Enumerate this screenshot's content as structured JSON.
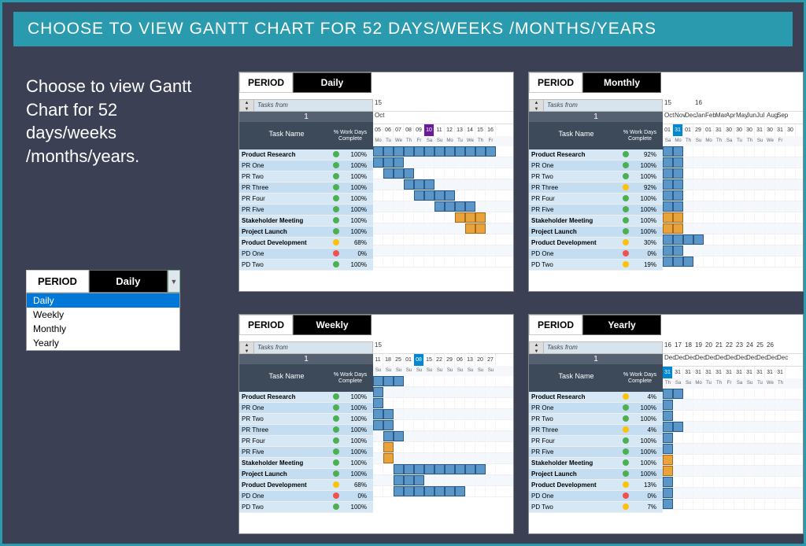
{
  "title": "CHOOSE TO VIEW GANTT CHART FOR 52 DAYS/WEEKS /MONTHS/YEARS",
  "description": "Choose to view Gantt Chart for 52 days/weeks /months/years.",
  "period_label": "PERIOD",
  "dropdown": {
    "selected": "Daily",
    "options": [
      "Daily",
      "Weekly",
      "Monthly",
      "Yearly"
    ]
  },
  "tasks_from_label": "Tasks from",
  "spin_value": "1",
  "task_name_header": "Task Name",
  "work_days_header": "% Work Days Complete",
  "tasks": [
    {
      "name": "Product Research",
      "bold": true
    },
    {
      "name": "PR One"
    },
    {
      "name": "PR Two"
    },
    {
      "name": "PR Three"
    },
    {
      "name": "PR Four"
    },
    {
      "name": "PR Five"
    },
    {
      "name": "Stakeholder Meeting",
      "bold": true
    },
    {
      "name": "Project Launch",
      "bold": true
    },
    {
      "name": "Product Development",
      "bold": true
    },
    {
      "name": "PD One"
    },
    {
      "name": "PD Two"
    }
  ],
  "panels": {
    "daily": {
      "period": "Daily",
      "year_row": [
        "15"
      ],
      "month_row": [
        "Oct"
      ],
      "dates": [
        "05",
        "06",
        "07",
        "08",
        "09",
        "10",
        "11",
        "12",
        "13",
        "14",
        "15",
        "16"
      ],
      "highlight": 5,
      "dow": [
        "Mo",
        "Tu",
        "We",
        "Th",
        "Fr",
        "Sa",
        "Su",
        "Mo",
        "Tu",
        "We",
        "Th",
        "Fr"
      ],
      "rows": [
        {
          "dot": "g",
          "pct": "100%",
          "bars": [
            [
              0,
              11,
              "b"
            ]
          ]
        },
        {
          "dot": "g",
          "pct": "100%",
          "bars": [
            [
              0,
              2,
              "b"
            ]
          ]
        },
        {
          "dot": "g",
          "pct": "100%",
          "bars": [
            [
              1,
              3,
              "b"
            ]
          ]
        },
        {
          "dot": "g",
          "pct": "100%",
          "bars": [
            [
              3,
              5,
              "b"
            ]
          ]
        },
        {
          "dot": "g",
          "pct": "100%",
          "bars": [
            [
              4,
              7,
              "b"
            ]
          ]
        },
        {
          "dot": "g",
          "pct": "100%",
          "bars": [
            [
              6,
              9,
              "b"
            ]
          ]
        },
        {
          "dot": "g",
          "pct": "100%",
          "bars": [
            [
              8,
              10,
              "o"
            ]
          ]
        },
        {
          "dot": "g",
          "pct": "100%",
          "bars": [
            [
              9,
              10,
              "o"
            ]
          ]
        },
        {
          "dot": "y",
          "pct": "68%",
          "bars": []
        },
        {
          "dot": "r",
          "pct": "0%",
          "bars": []
        },
        {
          "dot": "g",
          "pct": "100%",
          "bars": []
        }
      ]
    },
    "monthly": {
      "period": "Monthly",
      "year_row": [
        "15",
        "",
        "",
        "16"
      ],
      "month_row": [
        "Oct",
        "Nov",
        "Dec",
        "Jan",
        "Feb",
        "Mar",
        "Apr",
        "May",
        "Jun",
        "Jul",
        "Aug",
        "Sep"
      ],
      "dates": [
        "01",
        "31",
        "01",
        "29",
        "01",
        "31",
        "30",
        "30",
        "30",
        "31",
        "30",
        "31",
        "30"
      ],
      "highlight": 1,
      "dow": [
        "Sa",
        "Mo",
        "Th",
        "Su",
        "Mo",
        "Th",
        "Sa",
        "Tu",
        "Th",
        "Su",
        "We",
        "Fr"
      ],
      "rows": [
        {
          "dot": "g",
          "pct": "92%",
          "bars": [
            [
              0,
              1,
              "b"
            ]
          ]
        },
        {
          "dot": "g",
          "pct": "100%",
          "bars": [
            [
              0,
              1,
              "b"
            ]
          ]
        },
        {
          "dot": "g",
          "pct": "100%",
          "bars": [
            [
              0,
              1,
              "b"
            ]
          ]
        },
        {
          "dot": "y",
          "pct": "92%",
          "bars": [
            [
              0,
              1,
              "b"
            ]
          ]
        },
        {
          "dot": "g",
          "pct": "100%",
          "bars": [
            [
              0,
              1,
              "b"
            ]
          ]
        },
        {
          "dot": "g",
          "pct": "100%",
          "bars": [
            [
              0,
              1,
              "b"
            ]
          ]
        },
        {
          "dot": "g",
          "pct": "100%",
          "bars": [
            [
              0,
              1,
              "o"
            ]
          ]
        },
        {
          "dot": "g",
          "pct": "100%",
          "bars": [
            [
              0,
              1,
              "o"
            ]
          ]
        },
        {
          "dot": "y",
          "pct": "30%",
          "bars": [
            [
              0,
              3,
              "b"
            ]
          ]
        },
        {
          "dot": "r",
          "pct": "0%",
          "bars": [
            [
              0,
              1,
              "b"
            ]
          ]
        },
        {
          "dot": "y",
          "pct": "19%",
          "bars": [
            [
              0,
              2,
              "b"
            ]
          ]
        }
      ]
    },
    "weekly": {
      "period": "Weekly",
      "year_row": [
        "15"
      ],
      "month_row": [],
      "dates": [
        "11",
        "18",
        "25",
        "01",
        "08",
        "15",
        "22",
        "29",
        "06",
        "13",
        "20",
        "27"
      ],
      "highlight": 4,
      "dow": [
        "Su",
        "Su",
        "Su",
        "Su",
        "Su",
        "Su",
        "Su",
        "Su",
        "Su",
        "Su",
        "Su",
        "Su"
      ],
      "rows": [
        {
          "dot": "g",
          "pct": "100%",
          "bars": [
            [
              0,
              2,
              "b"
            ]
          ]
        },
        {
          "dot": "g",
          "pct": "100%",
          "bars": [
            [
              0,
              0,
              "b"
            ]
          ]
        },
        {
          "dot": "g",
          "pct": "100%",
          "bars": [
            [
              0,
              0,
              "b"
            ]
          ]
        },
        {
          "dot": "g",
          "pct": "100%",
          "bars": [
            [
              0,
              1,
              "b"
            ]
          ]
        },
        {
          "dot": "g",
          "pct": "100%",
          "bars": [
            [
              0,
              1,
              "b"
            ]
          ]
        },
        {
          "dot": "g",
          "pct": "100%",
          "bars": [
            [
              1,
              2,
              "b"
            ]
          ]
        },
        {
          "dot": "g",
          "pct": "100%",
          "bars": [
            [
              1,
              1,
              "o"
            ]
          ]
        },
        {
          "dot": "g",
          "pct": "100%",
          "bars": [
            [
              1,
              1,
              "o"
            ]
          ]
        },
        {
          "dot": "y",
          "pct": "68%",
          "bars": [
            [
              2,
              10,
              "b"
            ]
          ]
        },
        {
          "dot": "r",
          "pct": "0%",
          "bars": [
            [
              2,
              4,
              "b"
            ]
          ]
        },
        {
          "dot": "g",
          "pct": "100%",
          "bars": [
            [
              2,
              8,
              "b"
            ]
          ]
        }
      ]
    },
    "yearly": {
      "period": "Yearly",
      "year_row": [
        "16",
        "17",
        "18",
        "19",
        "20",
        "21",
        "22",
        "23",
        "24",
        "25",
        "26"
      ],
      "month_row": [
        "Dec",
        "Dec",
        "Dec",
        "Dec",
        "Dec",
        "Dec",
        "Dec",
        "Dec",
        "Dec",
        "Dec",
        "Dec",
        "Dec"
      ],
      "dates": [
        "31",
        "31",
        "31",
        "31",
        "31",
        "31",
        "31",
        "31",
        "31",
        "31",
        "31",
        "31"
      ],
      "highlight": 0,
      "dow": [
        "Th",
        "Sa",
        "Su",
        "Mo",
        "Tu",
        "Th",
        "Fr",
        "Sa",
        "Su",
        "Tu",
        "We",
        "Th"
      ],
      "rows": [
        {
          "dot": "y",
          "pct": "4%",
          "bars": [
            [
              0,
              1,
              "b"
            ]
          ]
        },
        {
          "dot": "g",
          "pct": "100%",
          "bars": [
            [
              0,
              0,
              "b"
            ]
          ]
        },
        {
          "dot": "g",
          "pct": "100%",
          "bars": [
            [
              0,
              0,
              "b"
            ]
          ]
        },
        {
          "dot": "y",
          "pct": "4%",
          "bars": [
            [
              0,
              1,
              "b"
            ]
          ]
        },
        {
          "dot": "g",
          "pct": "100%",
          "bars": [
            [
              0,
              0,
              "b"
            ]
          ]
        },
        {
          "dot": "g",
          "pct": "100%",
          "bars": [
            [
              0,
              0,
              "b"
            ]
          ]
        },
        {
          "dot": "g",
          "pct": "100%",
          "bars": [
            [
              0,
              0,
              "o"
            ]
          ]
        },
        {
          "dot": "g",
          "pct": "100%",
          "bars": [
            [
              0,
              0,
              "o"
            ]
          ]
        },
        {
          "dot": "y",
          "pct": "13%",
          "bars": [
            [
              0,
              0,
              "b"
            ]
          ]
        },
        {
          "dot": "r",
          "pct": "0%",
          "bars": [
            [
              0,
              0,
              "b"
            ]
          ]
        },
        {
          "dot": "y",
          "pct": "7%",
          "bars": [
            [
              0,
              0,
              "b"
            ]
          ]
        }
      ]
    }
  },
  "chart_data": {
    "type": "table",
    "title": "Gantt completion by period view",
    "series": [
      {
        "name": "Daily",
        "values": [
          100,
          100,
          100,
          100,
          100,
          100,
          100,
          100,
          68,
          0,
          100
        ]
      },
      {
        "name": "Monthly",
        "values": [
          92,
          100,
          100,
          92,
          100,
          100,
          100,
          100,
          30,
          0,
          19
        ]
      },
      {
        "name": "Weekly",
        "values": [
          100,
          100,
          100,
          100,
          100,
          100,
          100,
          100,
          68,
          0,
          100
        ]
      },
      {
        "name": "Yearly",
        "values": [
          4,
          100,
          100,
          4,
          100,
          100,
          100,
          100,
          13,
          0,
          7
        ]
      }
    ],
    "categories": [
      "Product Research",
      "PR One",
      "PR Two",
      "PR Three",
      "PR Four",
      "PR Five",
      "Stakeholder Meeting",
      "Project Launch",
      "Product Development",
      "PD One",
      "PD Two"
    ]
  }
}
